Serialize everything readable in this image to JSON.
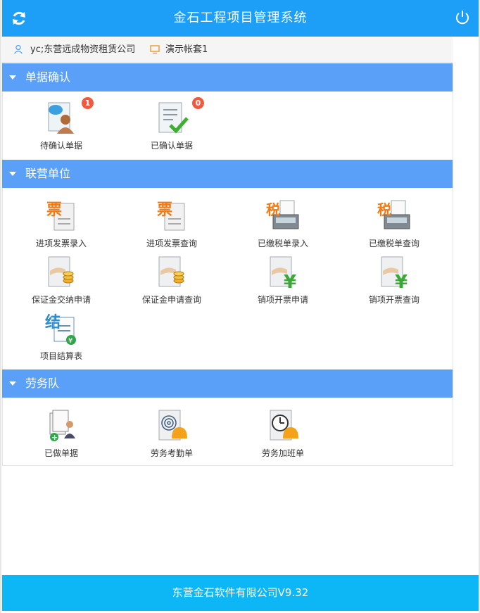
{
  "header": {
    "title": "金石工程项目管理系统",
    "refresh_icon": "refresh-icon",
    "power_icon": "power-icon"
  },
  "userbar": {
    "user": "yc;东营远成物资租赁公司",
    "account": "演示帐套1"
  },
  "sections": [
    {
      "title": "单据确认",
      "items": [
        {
          "label": "待确认单据",
          "icon": "pending-documents-icon",
          "badge": "1"
        },
        {
          "label": "已确认单据",
          "icon": "confirmed-documents-icon",
          "badge": "0"
        }
      ]
    },
    {
      "title": "联营单位",
      "items": [
        {
          "label": "进项发票录入",
          "icon": "invoice-icon",
          "glyph": "票"
        },
        {
          "label": "进项发票查询",
          "icon": "invoice-icon",
          "glyph": "票"
        },
        {
          "label": "已缴税单录入",
          "icon": "tax-register-icon",
          "glyph": "税"
        },
        {
          "label": "已缴税单查询",
          "icon": "tax-register-icon",
          "glyph": "税"
        },
        {
          "label": "保证金交纳申请",
          "icon": "deposit-coins-icon"
        },
        {
          "label": "保证金申请查询",
          "icon": "deposit-coins-icon"
        },
        {
          "label": "销项开票申请",
          "icon": "yen-invoice-icon"
        },
        {
          "label": "销项开票查询",
          "icon": "yen-invoice-icon"
        },
        {
          "label": "项目结算表",
          "icon": "settlement-icon",
          "glyph": "结"
        }
      ]
    },
    {
      "title": "劳务队",
      "items": [
        {
          "label": "已做单据",
          "icon": "worker-documents-icon"
        },
        {
          "label": "劳务考勤单",
          "icon": "fingerprint-attendance-icon"
        },
        {
          "label": "劳务加班单",
          "icon": "clock-overtime-icon"
        }
      ]
    }
  ],
  "footer": {
    "text": "东营金石软件有限公司V9.32"
  },
  "colors": {
    "header_bg": "#1e9ff7",
    "section_bg": "#5aa0f8",
    "footer_bg": "#0db7f5",
    "badge": "#ef5a3e"
  }
}
